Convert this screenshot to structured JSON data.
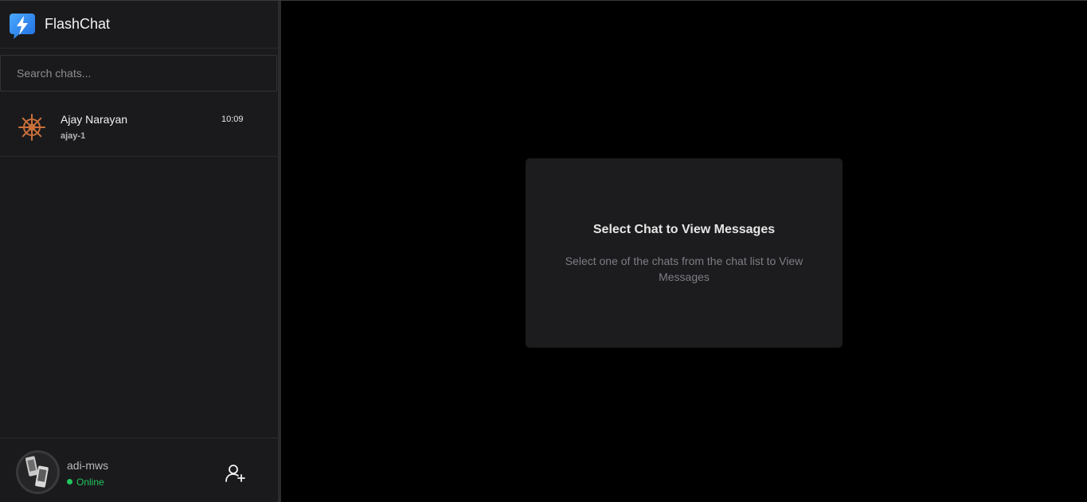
{
  "app": {
    "name": "FlashChat"
  },
  "search": {
    "placeholder": "Search chats..."
  },
  "chats": [
    {
      "name": "Ajay Narayan",
      "subtitle": "ajay-1",
      "time": "10:09",
      "avatar_icon": "ship-wheel-icon"
    }
  ],
  "current_user": {
    "username": "adi-mws",
    "status": "Online",
    "status_color": "#22c55e"
  },
  "empty_state": {
    "title": "Select Chat to View Messages",
    "description": "Select one of the chats from the chat list to View Messages"
  },
  "colors": {
    "brand_blue": "#2f8ff0",
    "accent_green": "#22c55e",
    "wheel_orange": "#c9703a"
  }
}
